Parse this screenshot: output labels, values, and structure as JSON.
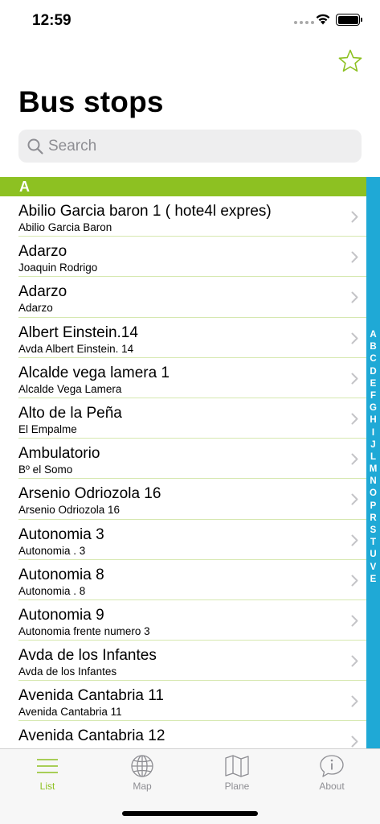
{
  "status_bar": {
    "time": "12:59"
  },
  "header": {
    "title": "Bus stops"
  },
  "search": {
    "placeholder": "Search",
    "value": ""
  },
  "section": {
    "letter": "A"
  },
  "stops": [
    {
      "name": "Abilio Garcia baron 1 ( hote4l expres)",
      "street": "Abilio Garcia Baron"
    },
    {
      "name": "Adarzo",
      "street": "Joaquin Rodrigo"
    },
    {
      "name": "Adarzo",
      "street": "Adarzo"
    },
    {
      "name": "Albert Einstein.14",
      "street": "Avda Albert Einstein. 14"
    },
    {
      "name": "Alcalde vega lamera 1",
      "street": "Alcalde Vega Lamera"
    },
    {
      "name": "Alto de la Peña",
      "street": "El Empalme"
    },
    {
      "name": "Ambulatorio",
      "street": "Bº el Somo"
    },
    {
      "name": "Arsenio Odriozola 16",
      "street": "Arsenio Odriozola 16"
    },
    {
      "name": "Autonomia 3",
      "street": "Autonomia . 3"
    },
    {
      "name": "Autonomia 8",
      "street": "Autonomia . 8"
    },
    {
      "name": "Autonomia 9",
      "street": "Autonomia frente numero 3"
    },
    {
      "name": "Avda de los Infantes",
      "street": "Avda de los Infantes"
    },
    {
      "name": "Avenida Cantabria 11",
      "street": "Avenida Cantabria 11"
    },
    {
      "name": "Avenida Cantabria 12",
      "street": ""
    }
  ],
  "index_letters": [
    "A",
    "B",
    "C",
    "D",
    "E",
    "F",
    "G",
    "H",
    "I",
    "J",
    "L",
    "M",
    "N",
    "O",
    "P",
    "R",
    "S",
    "T",
    "U",
    "V",
    "E"
  ],
  "tabs": [
    {
      "label": "List",
      "icon": "list-icon",
      "active": true
    },
    {
      "label": "Map",
      "icon": "globe-icon",
      "active": false
    },
    {
      "label": "Plane",
      "icon": "map-icon",
      "active": false
    },
    {
      "label": "About",
      "icon": "info-icon",
      "active": false
    }
  ],
  "colors": {
    "accent_green": "#8dc122",
    "index_blue": "#1fa9d6",
    "search_bg": "#eeeeef"
  }
}
